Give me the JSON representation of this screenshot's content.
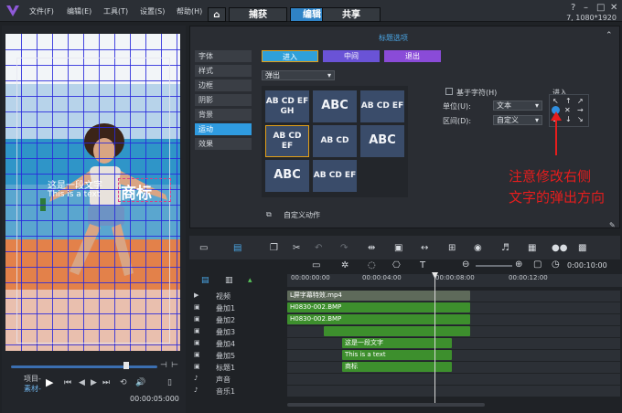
{
  "menubar": {
    "items": [
      "文件(F)",
      "编辑(E)",
      "工具(T)",
      "设置(S)",
      "帮助(H)"
    ],
    "home_icon": "home-icon",
    "tabs": [
      {
        "label": "捕获",
        "active": false
      },
      {
        "label": "编辑",
        "active": true
      },
      {
        "label": "共享",
        "active": false
      }
    ],
    "resolution": "7, 1080*1920"
  },
  "preview": {
    "overlay_text_cn": "这是一段文字",
    "overlay_text_en": "This is a text",
    "logo_text": "商标",
    "project_label": "项目-",
    "clip_label": "素材-",
    "timecode": "00:00:05:000"
  },
  "title_panel": {
    "header": "标题选项",
    "side_tabs": [
      "字体",
      "样式",
      "边框",
      "阴影",
      "背景",
      "运动",
      "效果"
    ],
    "active_side_tab": "运动",
    "mode_buttons": [
      {
        "label": "进入",
        "color": "#2fa0d9"
      },
      {
        "label": "中间",
        "color": "#6a53d6"
      },
      {
        "label": "退出",
        "color": "#8a4bd8"
      }
    ],
    "animation_type": "弹出",
    "animation_presets": [
      "AB CD EF GH",
      "ABC",
      "AB CD EF",
      "AB CD EF",
      "AB CD",
      "ABC",
      "ABC",
      "AB CD EF"
    ],
    "checkbox_label": "基于字符(H)",
    "unit_label": "单位(U):",
    "unit_value": "文本",
    "range_label": "区间(D):",
    "range_value": "自定义",
    "direction_label": "进入",
    "custom_action_label": "自定义动作"
  },
  "annotation": {
    "line1": "注意修改右侧",
    "line2": "文字的弹出方向"
  },
  "timeline": {
    "ruler_labels": [
      "00:00:00:00",
      "00:00:04:00",
      "00:00:08:00",
      "00:00:12:00"
    ],
    "timecode": "0:00:10:00",
    "tracks": [
      {
        "label": "视频",
        "clips": [
          {
            "text": "L屏字幕特效.mp4",
            "color": "#5e6a5a",
            "start": 0,
            "len": 200
          }
        ]
      },
      {
        "label": "叠加1",
        "clips": [
          {
            "text": "H0830-002.BMP",
            "color": "#3d8f2d",
            "start": 0,
            "len": 200
          }
        ]
      },
      {
        "label": "叠加2",
        "clips": [
          {
            "text": "H0830-002.BMP",
            "color": "#3d8f2d",
            "start": 0,
            "len": 200
          }
        ]
      },
      {
        "label": "叠加3",
        "clips": [
          {
            "text": "",
            "color": "#3d8f2d",
            "start": 40,
            "len": 160
          }
        ]
      },
      {
        "label": "叠加4",
        "clips": [
          {
            "text": "这是一段文字",
            "color": "#3d8f2d",
            "start": 60,
            "len": 120
          }
        ]
      },
      {
        "label": "叠加5",
        "clips": [
          {
            "text": "This is a text",
            "color": "#3d8f2d",
            "start": 60,
            "len": 120
          }
        ]
      },
      {
        "label": "标题1",
        "clips": [
          {
            "text": "商标",
            "color": "#3d8f2d",
            "start": 60,
            "len": 120
          }
        ]
      },
      {
        "label": "声音",
        "clips": []
      },
      {
        "label": "音乐1",
        "clips": []
      }
    ]
  }
}
